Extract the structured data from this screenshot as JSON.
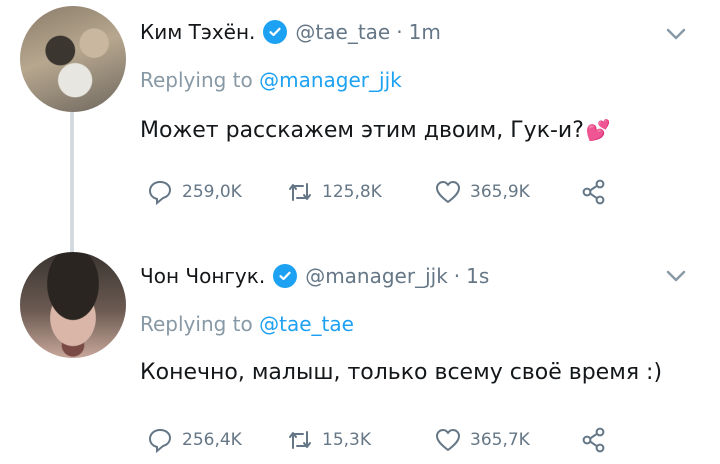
{
  "tweets": [
    {
      "author_name": "Ким Тэхён.",
      "handle": "@tae_tae",
      "separator": "·",
      "time": "1m",
      "replying_prefix": "Replying to",
      "replying_to": "@manager_jjk",
      "text": "Может расскажем этим двоим, Гук-и?",
      "emoji": "💕",
      "replies": "259,0K",
      "retweets": "125,8K",
      "likes": "365,9K"
    },
    {
      "author_name": "Чон Чонгук.",
      "handle": "@manager_jjk",
      "separator": "·",
      "time": "1s",
      "replying_prefix": "Replying to",
      "replying_to": "@tae_tae",
      "text": "Конечно, малыш, только всему своё время :)",
      "replies": "256,4K",
      "retweets": "15,3K",
      "likes": "365,7K"
    }
  ],
  "icons": {
    "verified": "verified-badge-icon",
    "menu": "chevron-down-icon",
    "reply": "reply-icon",
    "retweet": "retweet-icon",
    "like": "heart-icon",
    "share": "share-icon"
  },
  "colors": {
    "accent": "#1da1f2",
    "muted": "#657786",
    "text": "#14171a",
    "thread_line": "#d3dae0"
  }
}
